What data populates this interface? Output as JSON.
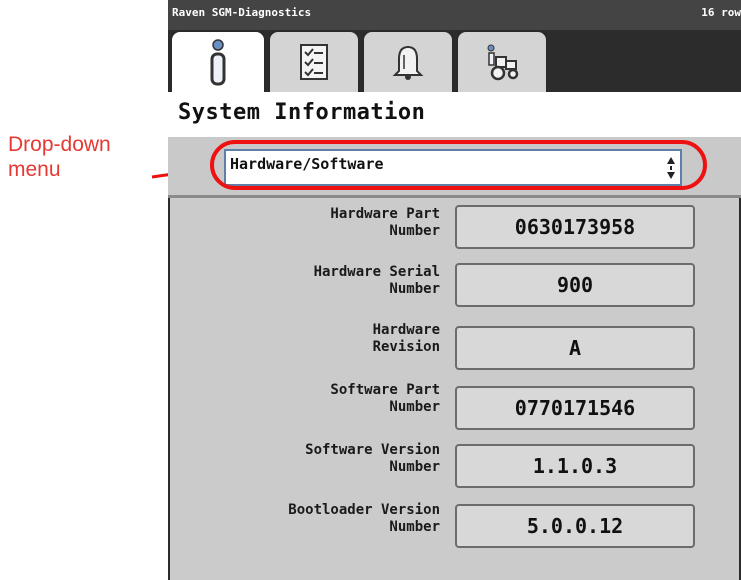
{
  "callout": {
    "label": "Drop-down menu",
    "color": "#e53935"
  },
  "titlebar": {
    "app_title": "Raven SGM-Diagnostics",
    "rows_text": "16 row"
  },
  "tabs": [
    {
      "icon": "info-icon",
      "active": true
    },
    {
      "icon": "checklist-icon",
      "active": false
    },
    {
      "icon": "alarm-bell-icon",
      "active": false
    },
    {
      "icon": "tractor-info-icon",
      "active": false
    }
  ],
  "page": {
    "title": "System Information"
  },
  "dropdown": {
    "selected": "Hardware/Software"
  },
  "fields": [
    {
      "label": "Hardware Part Number",
      "value": "0630173958"
    },
    {
      "label": "Hardware Serial Number",
      "value": "900"
    },
    {
      "label": "Hardware Revision",
      "value": "A"
    },
    {
      "label": "Software Part Number",
      "value": "0770171546"
    },
    {
      "label": "Software Version Number",
      "value": "1.1.0.3"
    },
    {
      "label": "Bootloader Version Number",
      "value": "5.0.0.12"
    }
  ]
}
